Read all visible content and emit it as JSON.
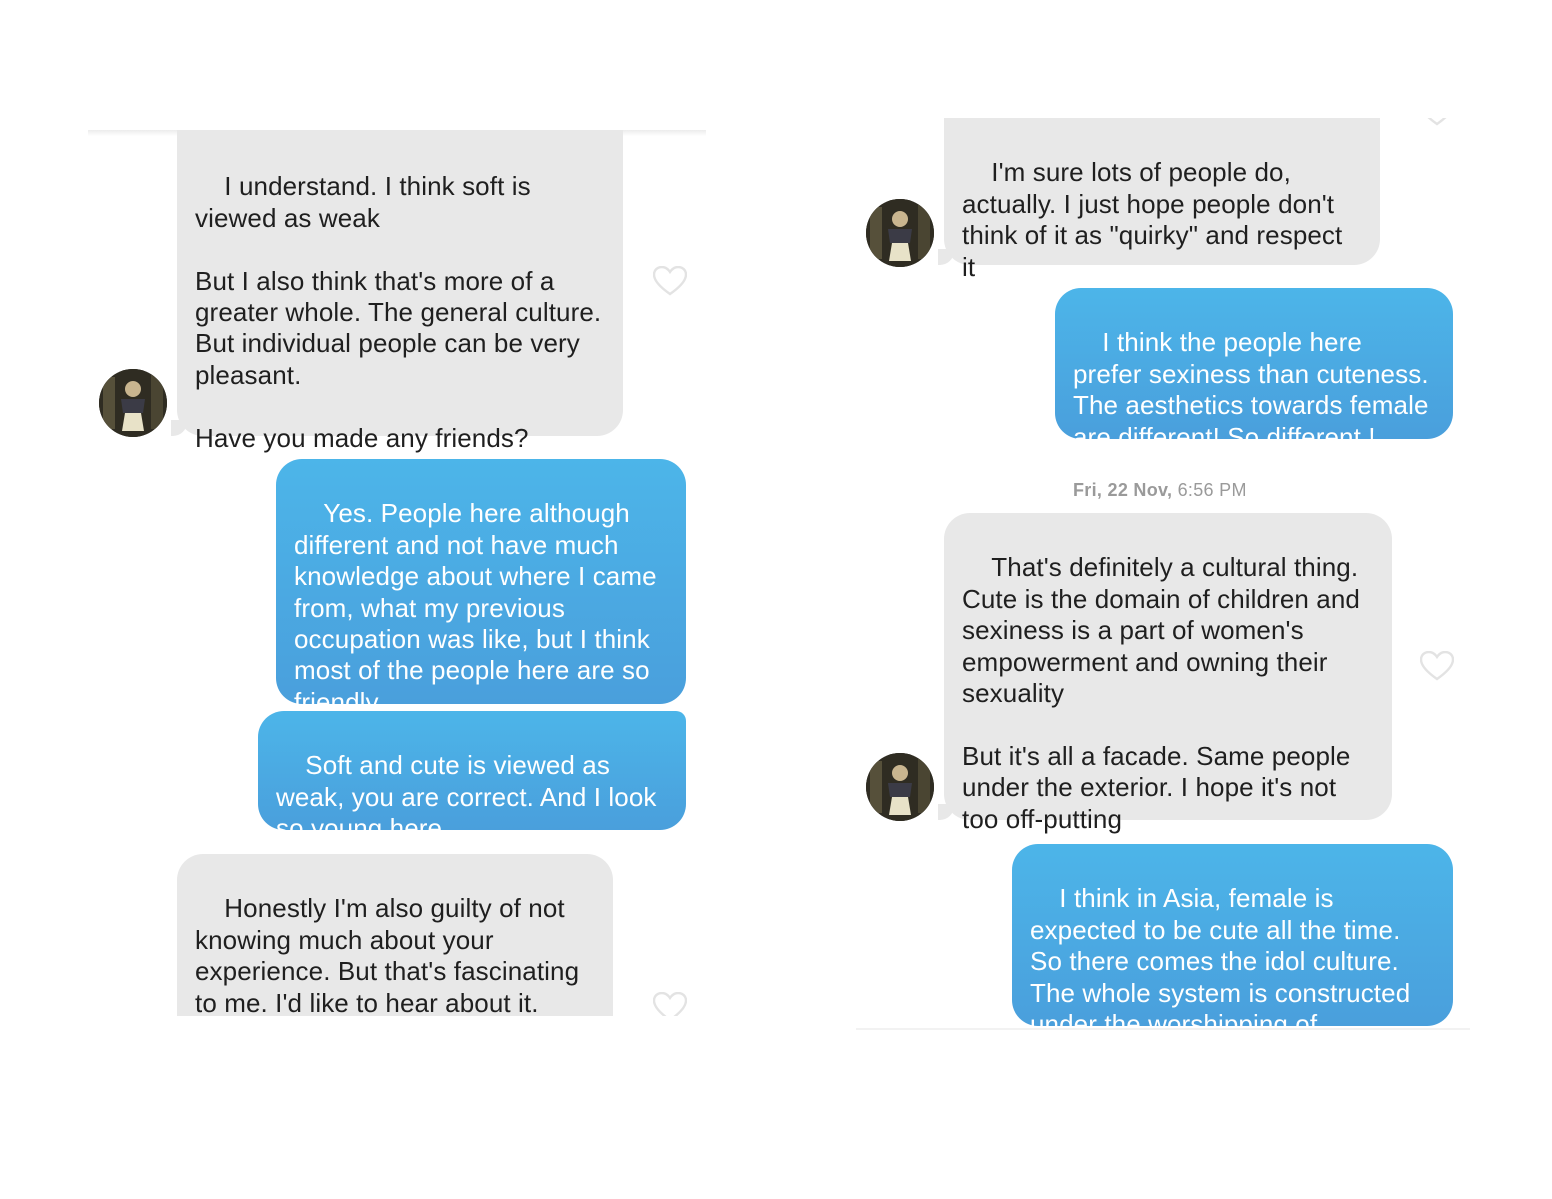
{
  "left_panel": {
    "messages": [
      {
        "sender": "them",
        "text": "I understand. I think soft is viewed as weak\n\nBut I also think that's more of a greater whole. The general culture. But individual people can be very pleasant.\n\nHave you made any friends?"
      },
      {
        "sender": "me",
        "text": "Yes. People here although different and not have much knowledge about where I came from, what my previous occupation was like, but I think most of the people here are so friendly."
      },
      {
        "sender": "me",
        "text": "Soft and cute is viewed as weak, you are correct. And I look so young here."
      },
      {
        "sender": "them",
        "text": "Honestly I'm also guilty of not knowing much about your experience. But that's fascinating to me. I'd like to hear about it."
      }
    ]
  },
  "right_panel": {
    "messages": [
      {
        "sender": "them",
        "text": "I'm sure lots of people do, actually. I just hope people don't think of it as \"quirky\" and respect it"
      },
      {
        "sender": "me",
        "text": "I think the people here prefer sexiness than cuteness. The aesthetics towards female are different! So different !"
      },
      {
        "sender": "them",
        "text": "That's definitely a cultural thing. Cute is the domain of children and sexiness is a part of women's empowerment and owning their sexuality\n\nBut it's all a facade. Same people under the exterior. I hope it's not too off-putting"
      },
      {
        "sender": "me",
        "text": "I think in Asia, female is expected to be cute all the time. So there comes the idol culture. The whole system is constructed under the worshipping of cuteness."
      }
    ],
    "date_stamp": {
      "day": "Fri, 22 Nov,",
      "time": "6:56 PM"
    }
  },
  "icons": {
    "like": "heart-outline-icon",
    "avatar": "profile-photo"
  },
  "colors": {
    "incoming_bubble": "#e8e8e8",
    "outgoing_bubble_top": "#4cb5e9",
    "outgoing_bubble_bottom": "#4a9fdc",
    "incoming_text": "#1f1f1f",
    "outgoing_text": "#ffffff",
    "heart": "#e3e3e3",
    "date_text": "#9a9a9a"
  }
}
